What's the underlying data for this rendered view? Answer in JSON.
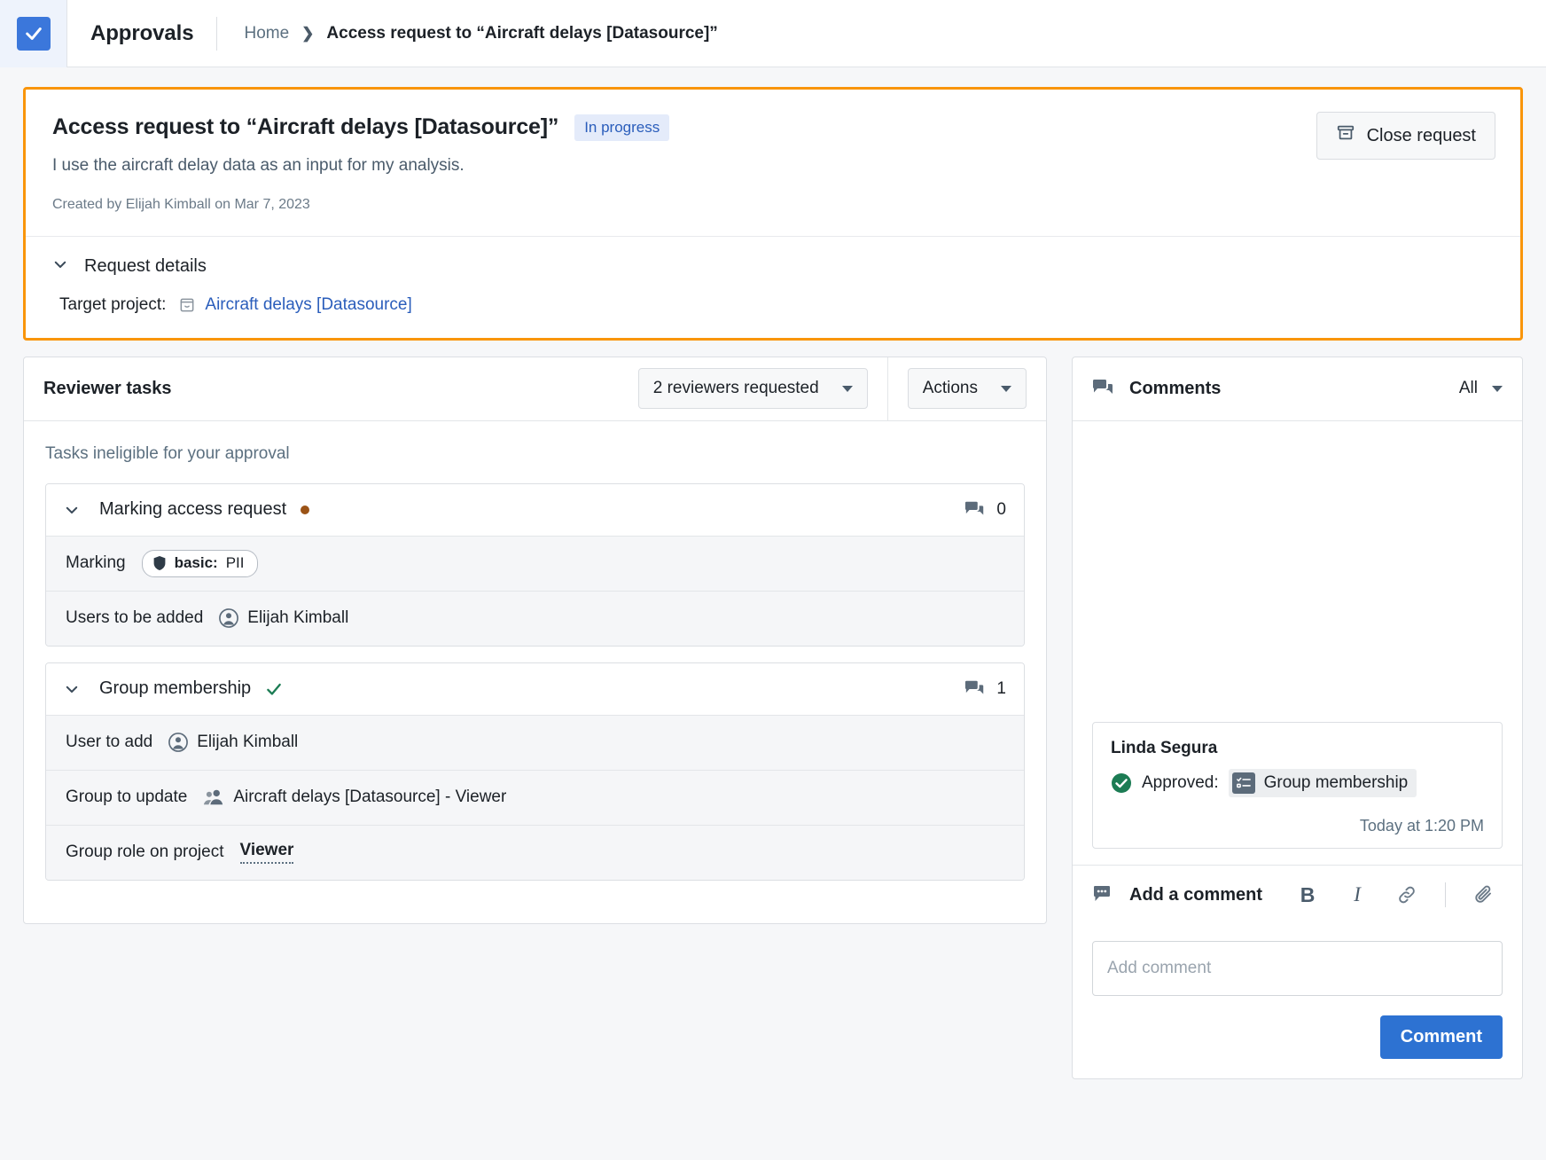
{
  "topbar": {
    "app_logo_icon": "check-square-icon",
    "app_title": "Approvals",
    "breadcrumb": {
      "home": "Home",
      "separator": "❯",
      "current": "Access request to “Aircraft delays [Datasource]”"
    }
  },
  "request": {
    "title": "Access request to “Aircraft delays [Datasource]”",
    "status_badge": "In progress",
    "description": "I use the aircraft delay data as an input for my analysis.",
    "created": "Created by Elijah Kimball on Mar 7, 2023",
    "close_button": "Close request",
    "close_button_icon": "archive-box-icon",
    "details_header": "Request details",
    "details_chevron_icon": "chevron-down-icon",
    "target_project_label": "Target project:",
    "target_project_icon": "project-icon",
    "target_project_value": "Aircraft delays [Datasource]",
    "highlight_color": "#f9950b"
  },
  "reviewer_tasks": {
    "title": "Reviewer tasks",
    "reviewers_dropdown": "2 reviewers requested",
    "actions_dropdown": "Actions",
    "subheading": "Tasks ineligible for your approval",
    "tasks": [
      {
        "name": "Marking access request",
        "status": "pending",
        "status_icon": "pending-dot-icon",
        "comment_count": "0",
        "comment_icon": "comments-icon",
        "chevron_icon": "chevron-down-icon",
        "rows": [
          {
            "label": "Marking",
            "value": "PII",
            "value_prefix": "basic:",
            "value_type": "marking-pill",
            "icon": "shield-icon"
          },
          {
            "label": "Users to be added",
            "value": "Elijah Kimball",
            "value_type": "user",
            "icon": "user-icon"
          }
        ]
      },
      {
        "name": "Group membership",
        "status": "approved",
        "status_icon": "check-icon",
        "comment_count": "1",
        "comment_icon": "comments-icon",
        "chevron_icon": "chevron-down-icon",
        "rows": [
          {
            "label": "User to add",
            "value": "Elijah Kimball",
            "value_type": "user",
            "icon": "user-icon"
          },
          {
            "label": "Group to update",
            "value": "Aircraft delays [Datasource] - Viewer",
            "value_type": "group",
            "icon": "group-icon"
          },
          {
            "label": "Group role on project",
            "value": "Viewer",
            "value_type": "role"
          }
        ]
      }
    ]
  },
  "comments": {
    "title": "Comments",
    "title_icon": "comments-icon",
    "filter": "All",
    "filter_caret_icon": "caret-down-icon",
    "items": [
      {
        "author": "Linda Segura",
        "action": "Approved:",
        "action_icon": "check-circle-icon",
        "task_chip": "Group membership",
        "task_chip_icon": "task-list-icon",
        "timestamp": "Today at 1:20 PM"
      }
    ],
    "compose": {
      "title": "Add a comment",
      "title_icon": "comment-dots-icon",
      "bold_label": "B",
      "bold_icon": "bold-icon",
      "italic_label": "I",
      "italic_icon": "italic-icon",
      "link_icon": "link-icon",
      "attach_icon": "paperclip-icon",
      "input_placeholder": "Add comment",
      "input_value": "",
      "submit_label": "Comment",
      "submit_color": "#2d72d2"
    }
  }
}
